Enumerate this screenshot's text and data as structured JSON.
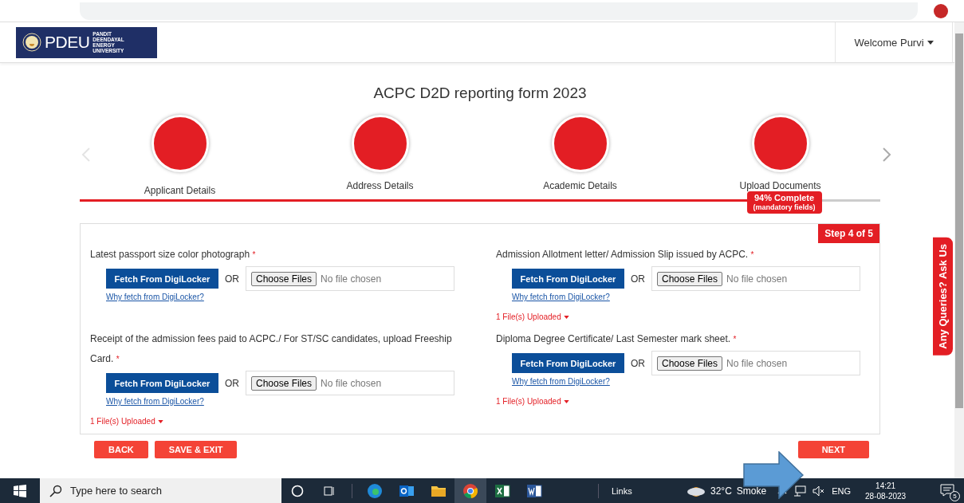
{
  "header": {
    "logo": {
      "name": "PDEU",
      "full_name": "PANDIT DEENDAYAL ENERGY UNIVERSITY"
    },
    "user_menu": "Welcome Purvi"
  },
  "form": {
    "title": "ACPC D2D reporting form 2023",
    "steps": [
      {
        "label": "Applicant Details",
        "selected": true
      },
      {
        "label": "Address Details",
        "selected": false
      },
      {
        "label": "Academic Details",
        "selected": false
      },
      {
        "label": "Upload Documents",
        "selected": false
      }
    ],
    "progress": {
      "level": 0.88,
      "label": "94% Complete",
      "sublabel": "(mandatory fields)"
    },
    "step_badge": "Step 4 of 5",
    "documents": [
      {
        "label": "Latest passport size color photograph",
        "required_mark": "*",
        "fetch_button": "Fetch From DigiLocker",
        "or": "OR",
        "choose_button": "Choose Files",
        "file_status": "No file chosen",
        "help_link": "Why fetch from DigiLocker?"
      },
      {
        "label": "Admission Allotment letter/ Admission Slip issued by ACPC.",
        "required_mark": "*",
        "fetch_button": "Fetch From DigiLocker",
        "or": "OR",
        "choose_button": "Choose Files",
        "file_status": "No file chosen",
        "help_link": "Why fetch from DigiLocker?",
        "uploaded": "1 File(s) Uploaded"
      },
      {
        "label": "Receipt of the admission fees paid to ACPC./ For ST/SC candidates, upload Freeship Card.",
        "required_mark": "*",
        "fetch_button": "Fetch From DigiLocker",
        "or": "OR",
        "choose_button": "Choose Files",
        "file_status": "No file chosen",
        "help_link": "Why fetch from DigiLocker?",
        "uploaded": "1 File(s) Uploaded"
      },
      {
        "label": "Diploma Degree Certificate/ Last Semester mark sheet.",
        "required_mark": "*",
        "fetch_button": "Fetch From DigiLocker",
        "or": "OR",
        "choose_button": "Choose Files",
        "file_status": "No file chosen",
        "help_link": "Why fetch from DigiLocker?",
        "uploaded": "1 File(s) Uploaded"
      }
    ],
    "buttons": {
      "back": "BACK",
      "save_exit": "SAVE & EXIT",
      "next": "NEXT"
    }
  },
  "side_tab": "Any Queries? Ask Us",
  "taskbar": {
    "search_placeholder": "Type here to search",
    "links": "Links",
    "weather": "32°C",
    "weather_text": "Smoke",
    "language": "ENG",
    "time": "14:21",
    "date": "28-08-2023",
    "notifications": "5"
  }
}
